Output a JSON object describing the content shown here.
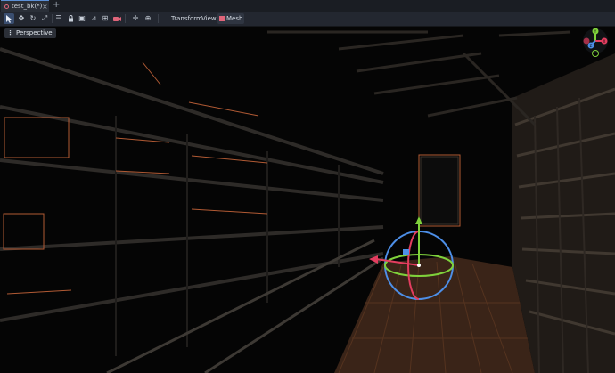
{
  "tabs": [
    {
      "label": "test_bk(*)",
      "icon": "scene-icon",
      "active": true
    }
  ],
  "toolbar": {
    "tools": [
      "select-icon",
      "move-icon",
      "rotate-icon",
      "scale-icon",
      "list-select-icon",
      "lock-icon",
      "group-icon",
      "ruler-icon",
      "snap-icon",
      "camera-override-icon",
      "local-space-icon",
      "grid-snap-icon"
    ],
    "menus": {
      "transform": "Transform",
      "view": "View",
      "mesh": "Mesh"
    }
  },
  "viewport": {
    "perspective_label": "Perspective",
    "gizmo_axes": [
      "X",
      "Y",
      "Z"
    ]
  },
  "colors": {
    "axis_x": "#e33d5f",
    "axis_y": "#7fd13b",
    "axis_z": "#4d8fe8",
    "accent": "#5b8fd6"
  }
}
